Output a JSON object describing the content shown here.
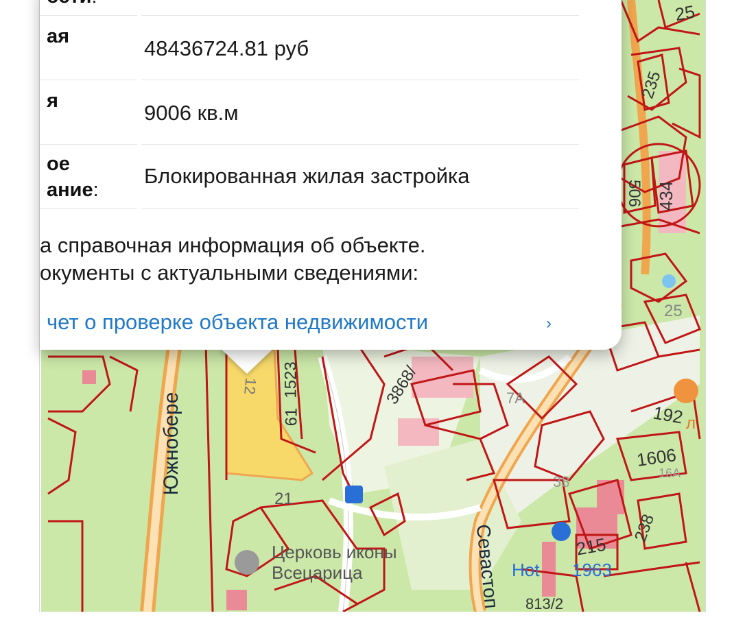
{
  "popup": {
    "label_top_fragment": "ости",
    "rows": [
      {
        "label_lines": [
          "ая"
        ],
        "value": "48436724.81 руб"
      },
      {
        "label_lines": [
          "я"
        ],
        "value": "9006 кв.м"
      },
      {
        "label_lines": [
          "ое",
          "ание"
        ],
        "value": "Блокированная жилая застройка"
      }
    ],
    "note_line1": "а справочная информация об объекте.",
    "note_line2": "окументы с актуальными сведениями:",
    "report_link": "чет о проверке объекта недвижимости",
    "report_chevron": "›"
  },
  "map": {
    "street_labels": [
      "Южнобере",
      "Севастоп"
    ],
    "parcel_labels": [
      "25",
      "235",
      "506",
      "434",
      "25",
      "1523",
      "61",
      "12",
      "3868/",
      "7А",
      "192",
      "1606",
      "16А",
      "38",
      "21",
      "215",
      "238",
      "813/2"
    ],
    "poi_labels": [
      "Церковь иконы",
      "Всецарица",
      "Hot",
      "1963",
      "л"
    ],
    "colors": {
      "green": "#cbe8a8",
      "road_orange": "#f0a64e",
      "parcel_red": "#c01616",
      "building_pink": "#f3b8c0",
      "highlight_yellow": "#f7d96a",
      "poi_blue": "#2a6fd6",
      "link_blue": "#1f78c8"
    }
  }
}
